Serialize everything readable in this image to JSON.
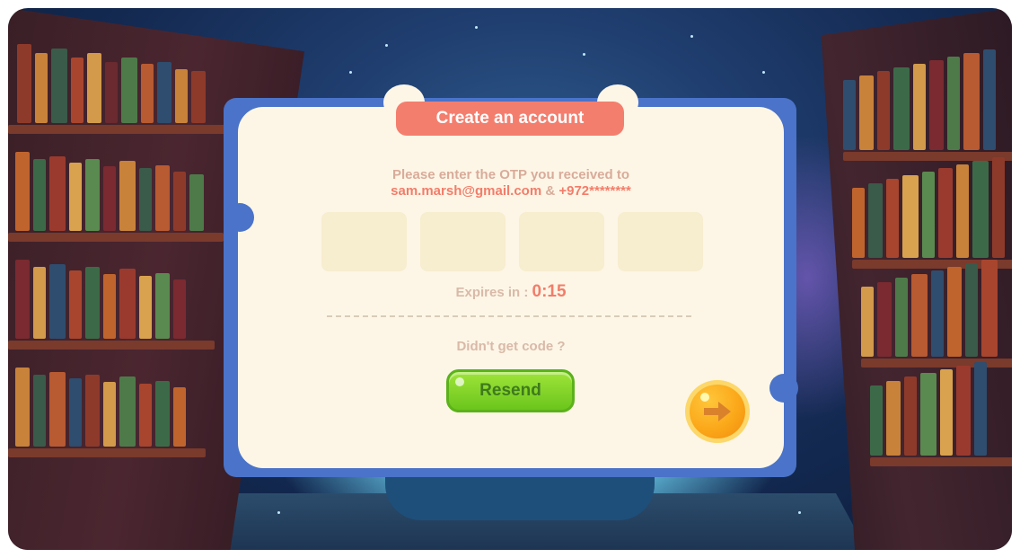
{
  "dialog": {
    "title": "Create an account",
    "instruction": "Please enter the OTP you received to",
    "email": "sam.marsh@gmail.com",
    "separator": "&",
    "phone": "+972********",
    "otp_boxes": [
      "",
      "",
      "",
      ""
    ],
    "expires_label": "Expires in :",
    "timer": "0:15",
    "no_code_label": "Didn't get code ?",
    "resend_label": "Resend",
    "next_icon": "arrow-right-icon"
  },
  "colors": {
    "card_border": "#4a73c9",
    "card_bg": "#fdf6e6",
    "title_bg": "#f47e6e",
    "accent_text": "#f27d6a",
    "resend_bg": "#7ed321",
    "next_bg": "#fba81a"
  }
}
